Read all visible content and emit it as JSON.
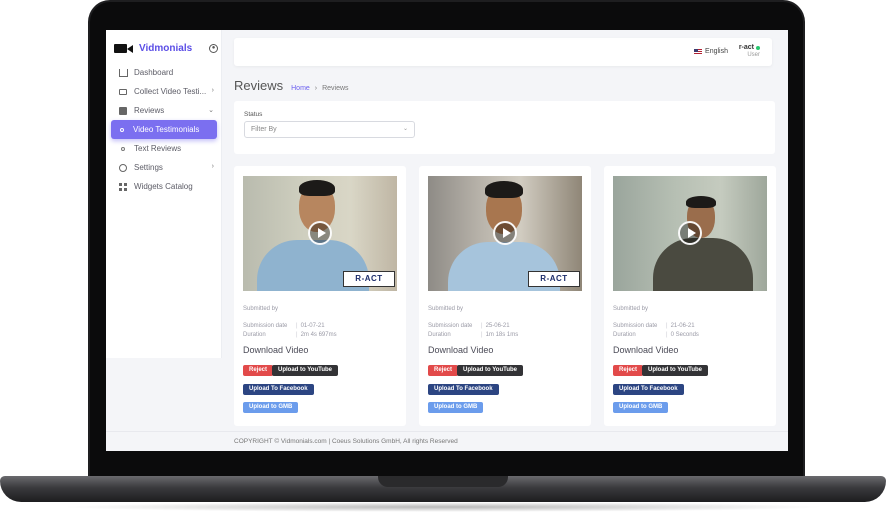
{
  "sidebar": {
    "brand": "Vidmonials",
    "items": [
      {
        "label": "Dashboard"
      },
      {
        "label": "Collect Video Testi..."
      },
      {
        "label": "Reviews"
      },
      {
        "label": "Video Testimonials"
      },
      {
        "label": "Text Reviews"
      },
      {
        "label": "Settings"
      },
      {
        "label": "Widgets Catalog"
      }
    ]
  },
  "header": {
    "language": "English",
    "user_name": "r-act",
    "user_role": "User"
  },
  "page": {
    "title": "Reviews",
    "breadcrumb_home": "Home",
    "breadcrumb_sep": "›",
    "breadcrumb_current": "Reviews"
  },
  "filter": {
    "label": "Status",
    "placeholder": "Filter By"
  },
  "reviews": [
    {
      "submitted_by_label": "Submitted by",
      "date_label": "Submission date",
      "date": "01-07-21",
      "duration_label": "Duration",
      "duration": "2m 4s 697ms",
      "download": "Download Video",
      "reject": "Reject",
      "youtube": "Upload to YouTube",
      "facebook": "Upload To Facebook",
      "gmb": "Upload to GMB",
      "logo": "R-ACT"
    },
    {
      "submitted_by_label": "Submitted by",
      "date_label": "Submission date",
      "date": "25-06-21",
      "duration_label": "Duration",
      "duration": "1m 18s 1ms",
      "download": "Download Video",
      "reject": "Reject",
      "youtube": "Upload to YouTube",
      "facebook": "Upload To Facebook",
      "gmb": "Upload to GMB",
      "logo": "R-ACT"
    },
    {
      "submitted_by_label": "Submitted by",
      "date_label": "Submission date",
      "date": "21-06-21",
      "duration_label": "Duration",
      "duration": "0 Seconds",
      "download": "Download Video",
      "reject": "Reject",
      "youtube": "Upload to YouTube",
      "facebook": "Upload To Facebook",
      "gmb": "Upload to GMB"
    }
  ],
  "footer": {
    "copyright": "COPYRIGHT © Vidmonials.com | Coeus Solutions GmbH, All rights Reserved"
  },
  "colors": {
    "accent": "#7b6ff0",
    "brand": "#5b4ee6",
    "reject": "#e24a4a",
    "youtube": "#333336",
    "facebook": "#2c4582",
    "gmb": "#6b9cec"
  }
}
